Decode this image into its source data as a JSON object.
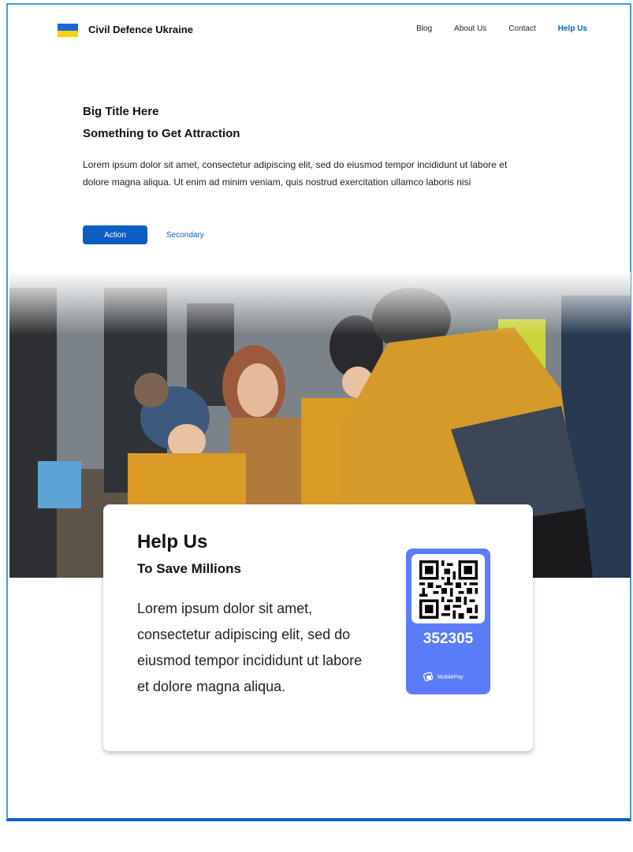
{
  "nav": {
    "brand": "Civil Defence Ukraine",
    "links": [
      {
        "label": "Blog"
      },
      {
        "label": "About Us"
      },
      {
        "label": "Contact"
      },
      {
        "label": "Help Us"
      }
    ]
  },
  "hero": {
    "title_line1": "Big Title Here",
    "title_line2": "Something to Get Attraction",
    "body": "Lorem ipsum dolor sit amet, consectetur adipiscing elit, sed do eiusmod tempor incididunt ut labore et dolore magna aliqua. Ut enim ad minim veniam, quis nostrud exercitation ullamco laboris nisi",
    "primary_label": "Action",
    "secondary_label": "Secondary"
  },
  "card": {
    "title": "Help Us",
    "subtitle": "To Save Millions",
    "body": "Lorem ipsum dolor sit amet, consectetur adipiscing elit, sed do eiusmod tempor incididunt ut labore et dolore magna aliqua.",
    "payment": {
      "code": "352305",
      "provider": "MobilePay"
    }
  },
  "colors": {
    "accent": "#0b5fc4",
    "flag_blue": "#1f64d6",
    "flag_yellow": "#f5d310",
    "payment_card": "#5b7cf7"
  },
  "icons": [
    "ukraine-flag-icon",
    "qr-code-icon",
    "mobilepay-icon"
  ]
}
